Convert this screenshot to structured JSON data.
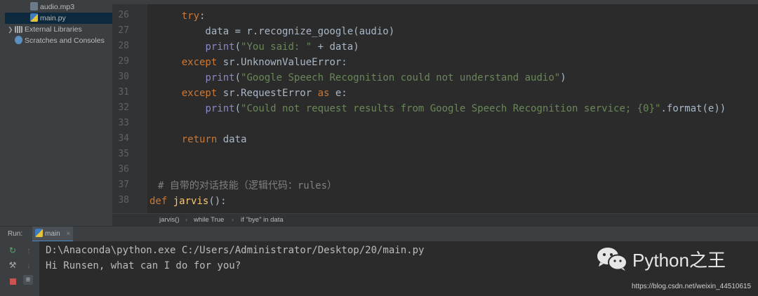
{
  "project_tree": {
    "items": [
      {
        "label": "audio.mp3",
        "icon": "audio-file-icon"
      },
      {
        "label": "main.py",
        "icon": "python-file-icon",
        "selected": true
      },
      {
        "label": "External Libraries",
        "icon": "library-icon"
      },
      {
        "label": "Scratches and Consoles",
        "icon": "scratches-icon"
      }
    ]
  },
  "editor": {
    "line_numbers": [
      "26",
      "27",
      "28",
      "29",
      "30",
      "31",
      "32",
      "33",
      "34",
      "35",
      "36",
      "37",
      "38"
    ]
  },
  "breadcrumbs": [
    "jarvis()",
    "while True",
    "if \"bye\" in data"
  ],
  "run_panel": {
    "run_label": "Run:",
    "tab_label": "main",
    "close_glyph": "×",
    "console_lines": [
      "D:\\Anaconda\\python.exe C:/Users/Administrator/Desktop/20/main.py",
      "Hi Runsen, what can I do for you?"
    ]
  },
  "watermark": {
    "brand": "Python之王",
    "url": "https://blog.csdn.net/weixin_44510615"
  }
}
